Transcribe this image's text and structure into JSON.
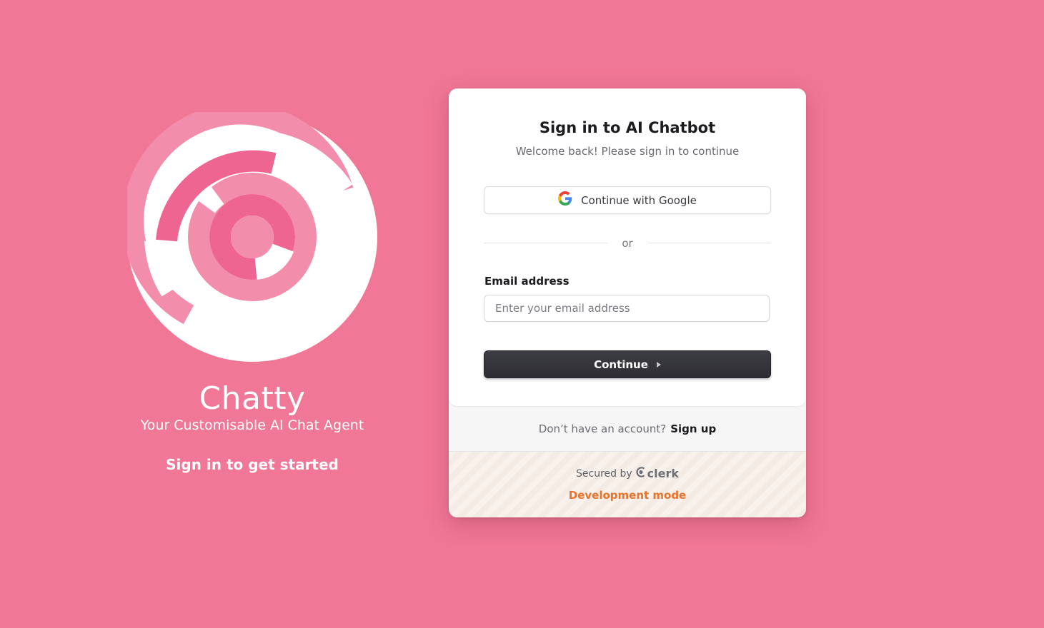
{
  "brand": {
    "name": "Chatty",
    "tagline": "Your Customisable AI Chat Agent",
    "cta": "Sign in to get started"
  },
  "signin": {
    "title": "Sign in to AI Chatbot",
    "subtitle": "Welcome back! Please sign in to continue",
    "google_button_label": "Continue with Google",
    "divider_text": "or",
    "email_label": "Email address",
    "email_placeholder": "Enter your email address",
    "email_value": "",
    "continue_label": "Continue",
    "no_account_text": "Don’t have an account?",
    "signup_link": "Sign up",
    "secured_by": "Secured by",
    "provider": "clerk",
    "dev_mode": "Development mode"
  },
  "colors": {
    "background": "#f07795",
    "accent_dark": "#2d2d33",
    "dev_mode": "#e8732a",
    "logo_pink_light": "#f38dac",
    "logo_pink_dark": "#ef6592"
  }
}
